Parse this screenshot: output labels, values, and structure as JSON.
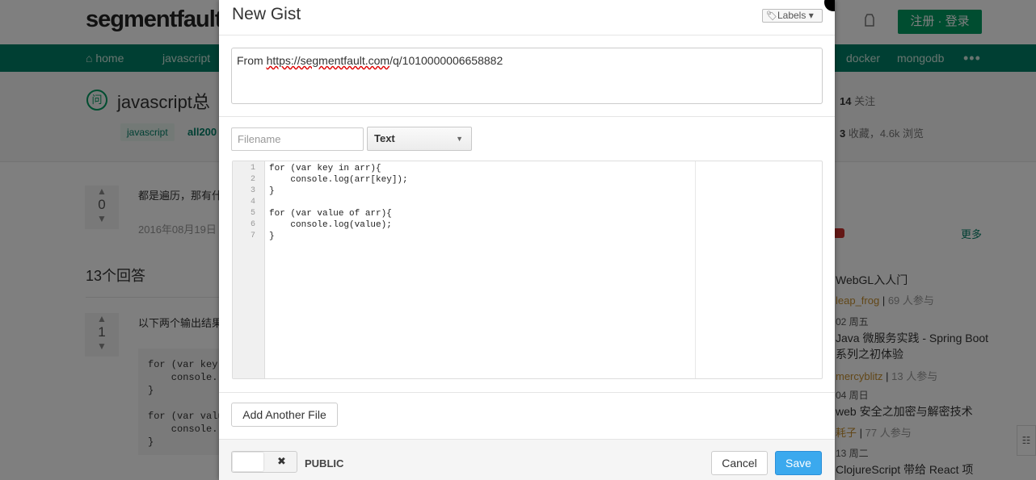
{
  "page": {
    "logo": "segmentfault",
    "register_login": "注册 · 登录",
    "nav": [
      "home",
      "javascript",
      "docker",
      "mongodb"
    ],
    "nav_more": "•••",
    "question_title": "javascript总",
    "tags": [
      "javascript",
      "all200"
    ],
    "follow_count": "14",
    "follow_label": "关注",
    "stats_count": "3",
    "stats_text": "收藏，4.6k 浏览",
    "question_votes": "0",
    "question_body": "都是遍历，那有什",
    "question_date": "2016年08月19日",
    "answers_title": "13个回答",
    "answer_votes": "1",
    "answer_text": "以下两个输出结果",
    "answer_code": [
      "for (var key",
      "    console.",
      "}",
      "",
      "for (var valu",
      "    console.",
      "}"
    ],
    "more_link": "更多",
    "events": [
      {
        "title": "WebGL入人门",
        "org": "leap_frog",
        "count": "69 人参与"
      },
      {
        "date": "02 周五",
        "title": "Java 微服务实践 - Spring Boot 系列之初体验",
        "org": "mercyblitz",
        "count": "13 人参与"
      },
      {
        "date": "04 周日",
        "title": "web 安全之加密与解密技术",
        "org": "耗子",
        "count": "77 人参与"
      },
      {
        "date": "13 周二",
        "title": "ClojureScript 带给 React 项"
      }
    ]
  },
  "modal": {
    "title": "New Gist",
    "labels_button": "Labels",
    "description": {
      "prefix": "From ",
      "url": "https://segmentfault.com",
      "suffix": "/q/1010000006658882"
    },
    "filename_placeholder": "Filename",
    "language": "Text",
    "code_lines": [
      "for (var key in arr){",
      "    console.log(arr[key]);",
      "}",
      "",
      "for (var value of arr){",
      "    console.log(value);",
      "}"
    ],
    "line_numbers": [
      "1",
      "2",
      "3",
      "4",
      "5",
      "6",
      "7"
    ],
    "add_file_button": "Add Another File",
    "toggle_icon": "✖",
    "visibility_label": "PUBLIC",
    "cancel_button": "Cancel",
    "save_button": "Save"
  },
  "colors": {
    "brand_green": "#009a61",
    "nav_green": "#017e66",
    "save_blue": "#3ba9ee"
  }
}
